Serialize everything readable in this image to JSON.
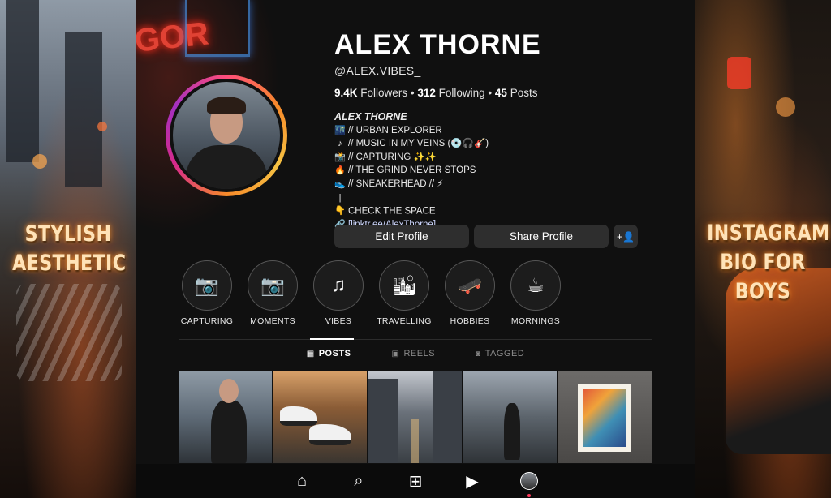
{
  "left_panel": {
    "caption_line1": "STYLISH",
    "caption_line2": "AESTHETIC"
  },
  "right_panel": {
    "caption_line1": "INSTAGRAM",
    "caption_line2": "BIO FOR BOYS"
  },
  "profile": {
    "name": "ALEX THORNE",
    "handle": "@ALEX.VIBES_",
    "stats": {
      "followers_value": "9.4K",
      "followers_label": "Followers",
      "following_value": "312",
      "following_label": "Following",
      "posts_value": "45",
      "posts_label": "Posts",
      "separator": "•"
    },
    "bio": {
      "title": "ALEX THORNE",
      "lines": [
        {
          "icon": "city-icon",
          "glyph": "🌃",
          "text": "// URBAN EXPLORER"
        },
        {
          "icon": "music-note-icon",
          "glyph": "♪",
          "text": "// MUSIC IN MY VEINS (💿🎧🎸)"
        },
        {
          "icon": "camera-icon",
          "glyph": "📸",
          "text": "// CAPTURING ✨✨"
        },
        {
          "icon": "fire-icon",
          "glyph": "🔥",
          "text": "// THE GRIND NEVER STOPS"
        },
        {
          "icon": "sneaker-icon",
          "glyph": "👟",
          "text": "// SNEAKERHEAD // ⚡"
        },
        {
          "icon": "pointing-down-icon",
          "glyph": "|👇",
          "text": "CHECK THE SPACE"
        }
      ],
      "link_icon": "link-icon",
      "link_text": "[linktr.ee/AlexThorne]"
    }
  },
  "actions": {
    "edit_label": "Edit Profile",
    "share_label": "Share Profile",
    "add_user_glyph": "+👤"
  },
  "highlights": [
    {
      "label": "CAPTURING",
      "icon": "camera-icon",
      "glyph": "📷"
    },
    {
      "label": "MOMENTS",
      "icon": "camera-icon",
      "glyph": "📷"
    },
    {
      "label": "VIBES",
      "icon": "music-note-icon",
      "glyph": "♫"
    },
    {
      "label": "TRAVELLING",
      "icon": "cityscape-icon",
      "glyph": "🏙"
    },
    {
      "label": "HOBBIES",
      "icon": "skateboard-icon",
      "glyph": "🛹"
    },
    {
      "label": "MORNINGS",
      "icon": "coffee-cup-icon",
      "glyph": "☕"
    }
  ],
  "tabs": [
    {
      "label": "POSTS",
      "icon": "grid-icon",
      "glyph": "▦",
      "active": true
    },
    {
      "label": "REELS",
      "icon": "reels-icon",
      "glyph": "▣",
      "active": false
    },
    {
      "label": "TAGGED",
      "icon": "tagged-icon",
      "glyph": "◙",
      "active": false
    }
  ],
  "posts": [
    {
      "subject": "portrait in city"
    },
    {
      "subject": "sneakers"
    },
    {
      "subject": "street vanishing point"
    },
    {
      "subject": "walking in street"
    },
    {
      "subject": "framed pop art portrait"
    }
  ],
  "bottom_nav": [
    {
      "name": "home-icon",
      "glyph": "⌂"
    },
    {
      "name": "search-icon",
      "glyph": "⌕"
    },
    {
      "name": "create-post-icon",
      "glyph": "⊞"
    },
    {
      "name": "reels-icon",
      "glyph": "▶"
    },
    {
      "name": "profile-avatar-icon",
      "glyph": ""
    }
  ],
  "colors": {
    "background": "#101010",
    "button_bg": "#2e2e2e",
    "story_ring": "#f78a2a",
    "caption_glow": "#ffe3b8",
    "notification_dot": "#ff3b5c"
  }
}
